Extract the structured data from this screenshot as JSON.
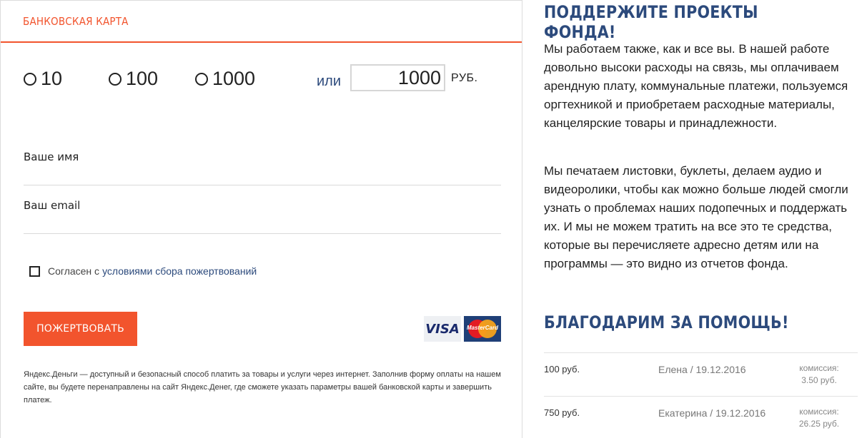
{
  "payment_form": {
    "tab_title": "БАНКОВСКАЯ КАРТА",
    "amount_options": [
      "10",
      "100",
      "1000"
    ],
    "or_label": "или",
    "custom_amount_value": "1000",
    "currency_label": "РУБ.",
    "name_label": "Ваше имя",
    "email_label": "Ваш email",
    "agree_prefix": "Согласен с",
    "agree_link": "условиями сбора пожертвований",
    "donate_button": "ПОЖЕРТВОВАТЬ",
    "visa_text": "VISA",
    "mastercard_text": "MasterCard",
    "disclaimer": "Яндекс.Деньги — доступный и безопасный способ платить за товары и услуги через интернет. Заполнив форму оплаты на нашем сайте, вы будете перенаправлены на сайт Яндекс.Денег, где сможете указать параметры вашей банковской карты и завершить платеж."
  },
  "support_section": {
    "title": "ПОДДЕРЖИТЕ ПРОЕКТЫ ФОНДА!",
    "paragraph1": "Мы работаем также, как и все вы. В нашей работе довольно высоки расходы на связь, мы оплачиваем арендную плату, коммунальные платежи, пользуемся оргтехникой и приобретаем расходные материалы, канцелярские товары и принадлежности.",
    "paragraph2": "Мы печатаем листовки, буклеты, делаем аудио и видеоролики, чтобы как можно больше людей смогли узнать о проблемах наших подопечных и поддержать их. И мы не можем тратить на все это те средства, которые вы перечисляете адресно детям или на программы — это видно из отчетов фонда."
  },
  "thanks_section": {
    "title": "БЛАГОДАРИМ ЗА ПОМОЩЬ!",
    "donations": [
      {
        "amount": "100 руб.",
        "donor": "Елена / 19.12.2016",
        "commission_label": "комиссия:",
        "commission_value": "3.50 руб."
      },
      {
        "amount": "750 руб.",
        "donor": "Екатерина / 19.12.2016",
        "commission_label": "комиссия:",
        "commission_value": "26.25 руб."
      }
    ]
  },
  "colors": {
    "accent": "#f2542d",
    "heading_blue": "#2c4a7c"
  }
}
